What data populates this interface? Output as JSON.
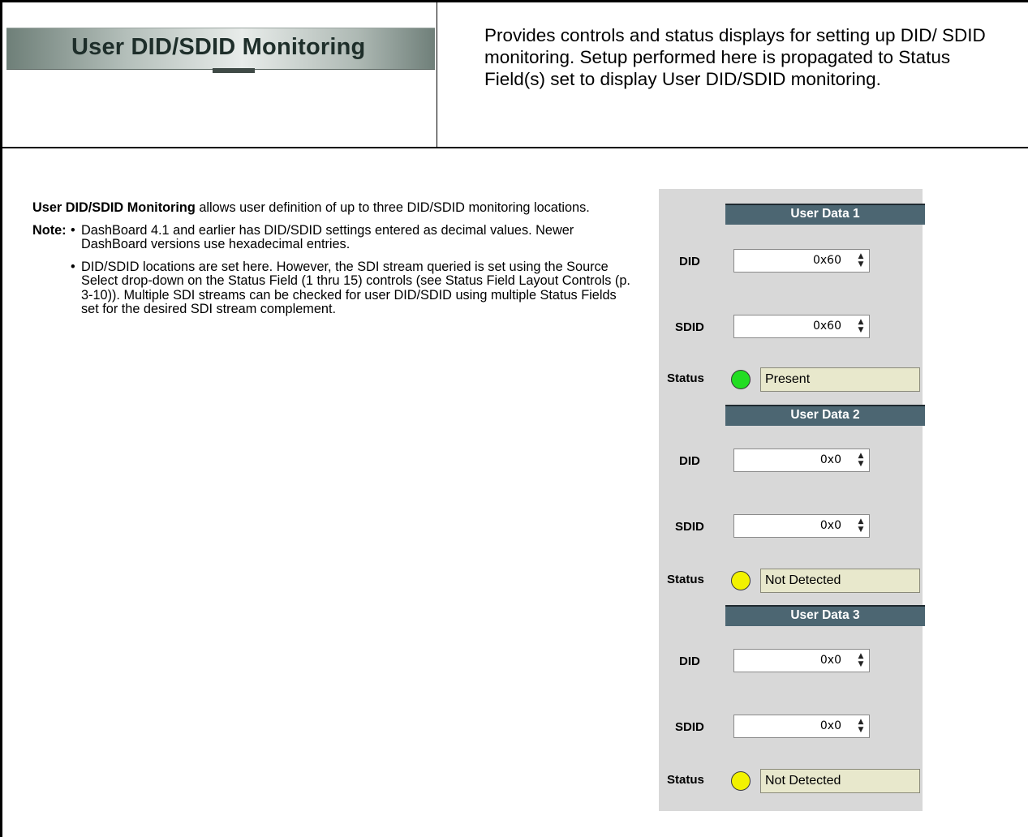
{
  "title": "User DID/SDID Monitoring",
  "description": "Provides controls and status displays for setting up DID/ SDID monitoring. Setup performed here is propagated to Status Field(s) set to display User DID/SDID monitoring.",
  "intro": {
    "bold": "User DID/SDID Monitoring",
    "rest": " allows user definition of up to three DID/SDID monitoring locations."
  },
  "note": {
    "label": "Note:",
    "bullet_char": "•",
    "bullets": [
      "DashBoard 4.1 and earlier has DID/SDID settings entered as decimal values. Newer DashBoard versions use hexadecimal entries.",
      "DID/SDID locations are set here. However, the SDI stream queried is set using the Source Select drop-down on the Status Field (1 thru 15) controls (see Status Field Layout Controls (p. 3-10)). Multiple SDI streams can be checked for user DID/SDID using multiple Status Fields set for the desired SDI stream complement."
    ]
  },
  "panel": {
    "labels": {
      "did": "DID",
      "sdid": "SDID",
      "status": "Status"
    },
    "spinner": {
      "up": "▲",
      "down": "▼"
    },
    "groups": [
      {
        "header": "User Data 1",
        "did": "0x60",
        "sdid": "0x60",
        "status": "Present",
        "led_color": "#22dd22"
      },
      {
        "header": "User Data 2",
        "did": "0x0",
        "sdid": "0x0",
        "status": "Not Detected",
        "led_color": "#f2f200"
      },
      {
        "header": "User Data 3",
        "did": "0x0",
        "sdid": "0x0",
        "status": "Not Detected",
        "led_color": "#f2f200"
      }
    ]
  }
}
